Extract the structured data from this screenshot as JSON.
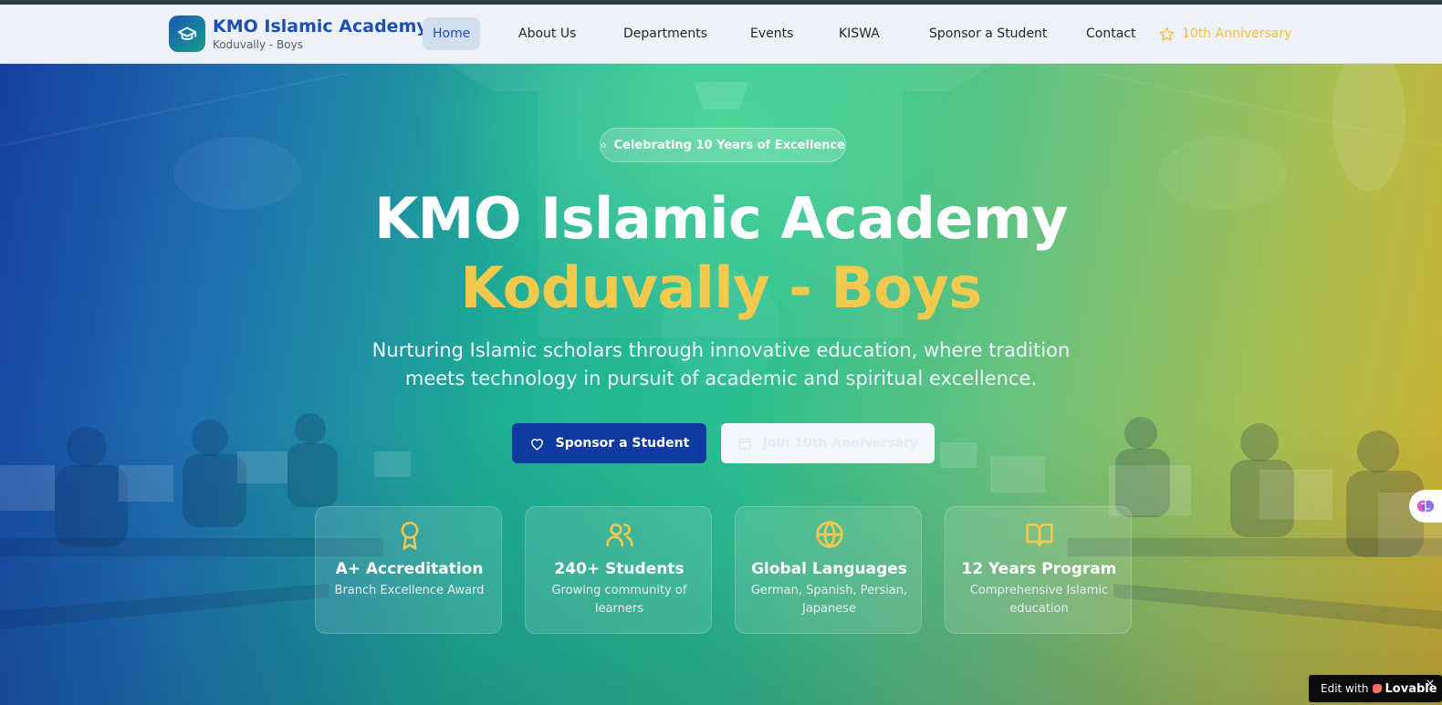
{
  "nav": {
    "brand_title": "KMO Islamic Academy",
    "brand_subtitle": "Koduvally - Boys",
    "items": [
      {
        "label": "Home",
        "active": true
      },
      {
        "label": "About Us"
      },
      {
        "label": "Departments"
      },
      {
        "label": "Events"
      },
      {
        "label": "KISWA"
      },
      {
        "label": "Sponsor a Student"
      },
      {
        "label": "Contact"
      }
    ],
    "anniversary_label": "10th Anniversary"
  },
  "hero": {
    "badge": "Celebrating 10 Years of Excellence",
    "title_line1": "KMO Islamic Academy",
    "title_line2": "Koduvally - Boys",
    "description": "Nurturing Islamic scholars through innovative education, where tradition meets technology in pursuit of academic and spiritual excellence.",
    "primary_button": "Sponsor a Student",
    "secondary_button": "Join 10th Anniversary"
  },
  "stats": [
    {
      "icon": "award-icon",
      "title": "A+ Accreditation",
      "subtitle": "Branch Excellence Award"
    },
    {
      "icon": "users-icon",
      "title": "240+ Students",
      "subtitle": "Growing community of learners"
    },
    {
      "icon": "globe-icon",
      "title": "Global Languages",
      "subtitle": "German, Spanish, Persian, Japanese"
    },
    {
      "icon": "book-open-icon",
      "title": "12 Years Program",
      "subtitle": "Comprehensive Islamic education"
    }
  ],
  "widgets": {
    "edit_with": "Edit with",
    "lovable": "Lovable",
    "close": "×"
  },
  "colors": {
    "brand_blue": "#1c4fb5",
    "accent_gold": "#f3c94e",
    "primary_button": "#0f3ba1",
    "nav_bg": "#eef2f7"
  }
}
